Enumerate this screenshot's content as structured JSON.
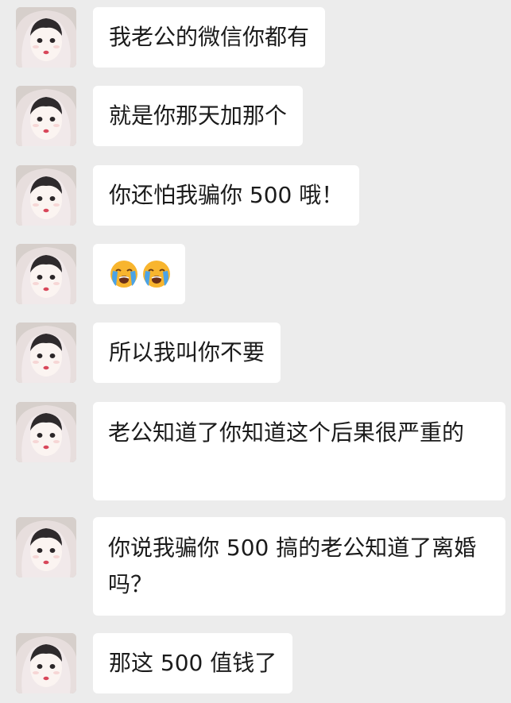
{
  "messages": [
    {
      "text": "我老公的微信你都有"
    },
    {
      "text": "就是你那天加那个"
    },
    {
      "text": "你还怕我骗你 500 哦！"
    },
    {
      "emojis": [
        "loudly-crying-face-icon",
        "loudly-crying-face-icon"
      ]
    },
    {
      "text": "所以我叫你不要"
    },
    {
      "text": "老公知道了你知道这个后果很严重的"
    },
    {
      "text": "你说我骗你 500 搞的老公知道了离婚吗？"
    },
    {
      "text": "那这 500 值钱了"
    }
  ],
  "colors": {
    "background": "#ececec",
    "bubble": "#ffffff",
    "text": "#1b1b1b"
  }
}
